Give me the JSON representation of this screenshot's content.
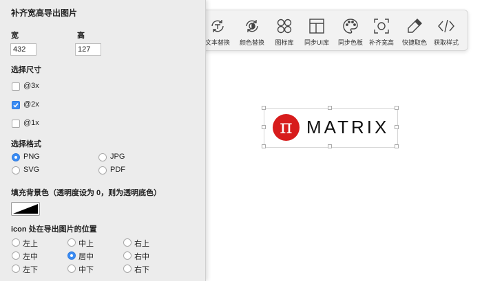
{
  "toolbar": {
    "items": [
      {
        "label": "文本替换",
        "icon": "text-replace-icon"
      },
      {
        "label": "颜色替换",
        "icon": "color-replace-icon"
      },
      {
        "label": "图标库",
        "icon": "icon-library-icon"
      },
      {
        "label": "同步UI库",
        "icon": "sync-ui-library-icon"
      },
      {
        "label": "同步色板",
        "icon": "sync-palette-icon"
      },
      {
        "label": "补齐宽高",
        "icon": "fill-size-icon"
      },
      {
        "label": "快捷取色",
        "icon": "eyedropper-icon"
      },
      {
        "label": "获取样式",
        "icon": "code-icon"
      }
    ]
  },
  "canvas": {
    "logo_symbol": "π",
    "logo_text": "MATRIX",
    "logo_color": "#d71c1c"
  },
  "panel": {
    "title": "补齐宽高导出图片",
    "width_label": "宽",
    "height_label": "高",
    "width_value": "432",
    "height_value": "127",
    "size_section_label": "选择尺寸",
    "sizes": [
      {
        "label": "@3x",
        "checked": false
      },
      {
        "label": "@2x",
        "checked": true
      },
      {
        "label": "@1x",
        "checked": false
      }
    ],
    "format_section_label": "选择格式",
    "formats": [
      {
        "label": "PNG",
        "checked": true
      },
      {
        "label": "JPG",
        "checked": false
      },
      {
        "label": "SVG",
        "checked": false
      },
      {
        "label": "PDF",
        "checked": false
      }
    ],
    "bg_label": "填充背景色（透明度设为 0，则为透明底色）",
    "position_label": "icon 处在导出图片的位置",
    "positions": [
      {
        "label": "左上",
        "checked": false
      },
      {
        "label": "中上",
        "checked": false
      },
      {
        "label": "右上",
        "checked": false
      },
      {
        "label": "左中",
        "checked": false
      },
      {
        "label": "居中",
        "checked": true
      },
      {
        "label": "右中",
        "checked": false
      },
      {
        "label": "左下",
        "checked": false
      },
      {
        "label": "中下",
        "checked": false
      },
      {
        "label": "右下",
        "checked": false
      }
    ],
    "accent_color": "#3b8cf3"
  }
}
